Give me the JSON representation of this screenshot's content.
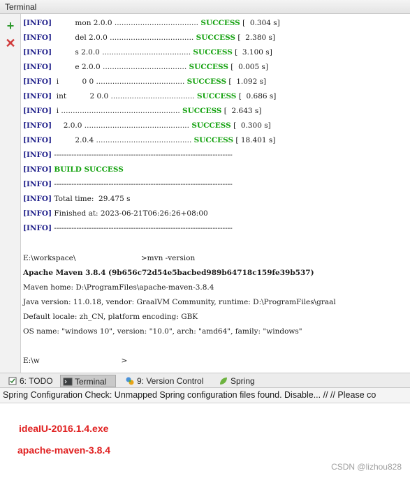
{
  "window": {
    "title": "Terminal"
  },
  "toolbar": {
    "add_icon": "plus-icon",
    "close_icon": "close-icon"
  },
  "terminal": {
    "build_lines": [
      {
        "prefix": "[INFO]",
        "name": "          mon 2.0.0",
        "dots": " .................................... ",
        "status": "SUCCESS",
        "time": "[  0.304 s]"
      },
      {
        "prefix": "[INFO]",
        "name": "          del 2.0.0",
        "dots": " .................................... ",
        "status": "SUCCESS",
        "time": "[  2.380 s]"
      },
      {
        "prefix": "[INFO]",
        "name": "          s 2.0.0",
        "dots": " ...................................... ",
        "status": "SUCCESS",
        "time": "[  3.100 s]"
      },
      {
        "prefix": "[INFO]",
        "name": "          e 2.0.0",
        "dots": " .................................... ",
        "status": "SUCCESS",
        "time": "[  0.005 s]"
      },
      {
        "prefix": "[INFO]",
        "name": "  i          0 0",
        "dots": " ...................................... ",
        "status": "SUCCESS",
        "time": "[  1.092 s]"
      },
      {
        "prefix": "[INFO]",
        "name": "  int          2 0.0",
        "dots": " .................................... ",
        "status": "SUCCESS",
        "time": "[  0.686 s]"
      },
      {
        "prefix": "[INFO]",
        "name": "  i",
        "dots": " ................................................... ",
        "status": "SUCCESS",
        "time": "[  2.643 s]"
      },
      {
        "prefix": "[INFO]",
        "name": "     2.0.0",
        "dots": " ............................................. ",
        "status": "SUCCESS",
        "time": "[  0.300 s]"
      },
      {
        "prefix": "[INFO]",
        "name": "          2.0.4",
        "dots": " ......................................... ",
        "status": "SUCCESS",
        "time": "[ 18.401 s]"
      }
    ],
    "separator": "------------------------------------------------------------------------",
    "info_prefix": "[INFO]",
    "build_success": "BUILD SUCCESS",
    "total_time": "Total time:  29.475 s",
    "finished_at": "Finished at: 2023-06-21T06:26:26+08:00",
    "command_line": "E:\\workspace\\                            >mvn -version",
    "maven_version": "Apache Maven 3.8.4 (9b656c72d54e5bacbed989b64718c159fe39b537)",
    "maven_home": "Maven home: D:\\ProgramFiles\\apache-maven-3.8.4",
    "java_version": "Java version: 11.0.18, vendor: GraalVM Community, runtime: D:\\ProgramFiles\\graal",
    "default_locale": "Default locale: zh_CN, platform encoding: GBK",
    "os_name": "OS name: \"windows 10\", version: \"10.0\", arch: \"amd64\", family: \"windows\"",
    "prompt_line": "E:\\w                                   >"
  },
  "bottom_tabs": [
    {
      "label": "6: TODO",
      "icon": "todo-icon"
    },
    {
      "label": "Terminal",
      "icon": "terminal-icon",
      "active": true
    },
    {
      "label": "9: Version Control",
      "icon": "version-control-icon"
    },
    {
      "label": "Spring",
      "icon": "spring-leaf-icon"
    }
  ],
  "status_bar": {
    "message": "Spring Configuration Check: Unmapped Spring configuration files found. Disable... // // Please co"
  },
  "notes": [
    "ideaIU-2016.1.4.exe",
    "apache-maven-3.8.4"
  ],
  "watermark": "CSDN @lizhou828",
  "colors": {
    "info": "#1f1f8a",
    "success": "#13a10e",
    "note": "#e02020"
  }
}
